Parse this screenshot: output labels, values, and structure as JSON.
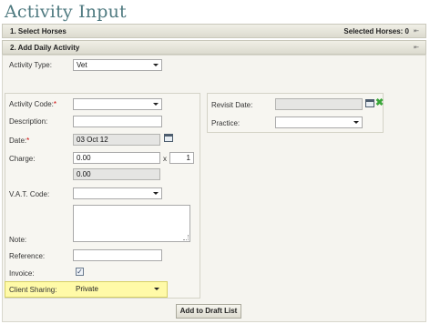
{
  "page": {
    "title": "Activity Input"
  },
  "sections": {
    "select_horses": {
      "label": "1. Select Horses",
      "right_label": "Selected Horses: 0"
    },
    "add_daily_activity": {
      "label": "2. Add Daily Activity"
    }
  },
  "form": {
    "activity_type": {
      "label": "Activity Type:",
      "value": "Vet"
    },
    "activity_code": {
      "label": "Activity Code:",
      "required": "*",
      "value": ""
    },
    "description": {
      "label": "Description:",
      "value": ""
    },
    "date": {
      "label": "Date:",
      "required": "*",
      "value": "03 Oct 12"
    },
    "charge": {
      "label": "Charge:",
      "value": "0.00",
      "multiplier_symbol": "x",
      "quantity": "1",
      "total": "0.00"
    },
    "vat_code": {
      "label": "V.A.T. Code:",
      "value": ""
    },
    "note": {
      "label": "Note:",
      "value": ""
    },
    "reference": {
      "label": "Reference:",
      "value": ""
    },
    "invoice": {
      "label": "Invoice:",
      "checked": true,
      "check_glyph": "✓"
    },
    "client_sharing": {
      "label": "Client Sharing:",
      "value": "Private"
    },
    "revisit_date": {
      "label": "Revisit Date:",
      "value": ""
    },
    "practice": {
      "label": "Practice:",
      "value": ""
    }
  },
  "buttons": {
    "add_to_draft": "Add to Draft List"
  },
  "icons": {
    "collapse": "collapse-icon",
    "calendar": "calendar-icon",
    "clear": "clear-x-icon",
    "dropdown": "chevron-down-icon"
  },
  "colors": {
    "title": "#4f7a80",
    "required": "#cc0000",
    "highlight": "#fffaa8",
    "clear_icon": "#3aa63a"
  }
}
